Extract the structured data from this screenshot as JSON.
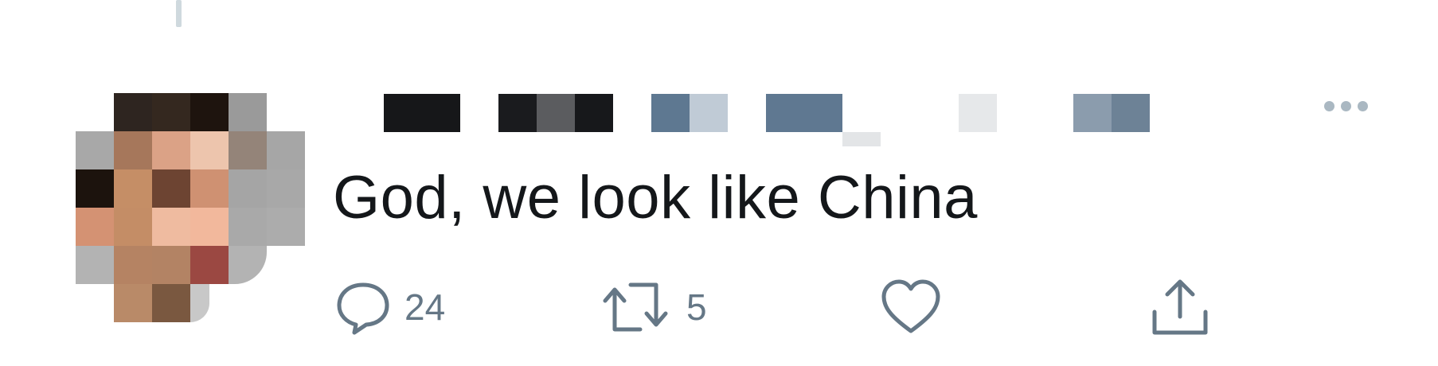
{
  "tweet": {
    "text": "God, we look like China",
    "author_name_visible": false,
    "avatar_pixelated": true
  },
  "actions": {
    "reply": {
      "icon": "speech-bubble-icon",
      "count": "24"
    },
    "retweet": {
      "icon": "retweet-icon",
      "count": "5"
    },
    "like": {
      "icon": "heart-icon",
      "count": ""
    },
    "share": {
      "icon": "share-icon",
      "count": ""
    }
  },
  "colors": {
    "text": "#14171a",
    "icon_gray": "#657786",
    "muted": "#aab8c2",
    "thread_line": "#cfd9de",
    "background": "#ffffff"
  }
}
